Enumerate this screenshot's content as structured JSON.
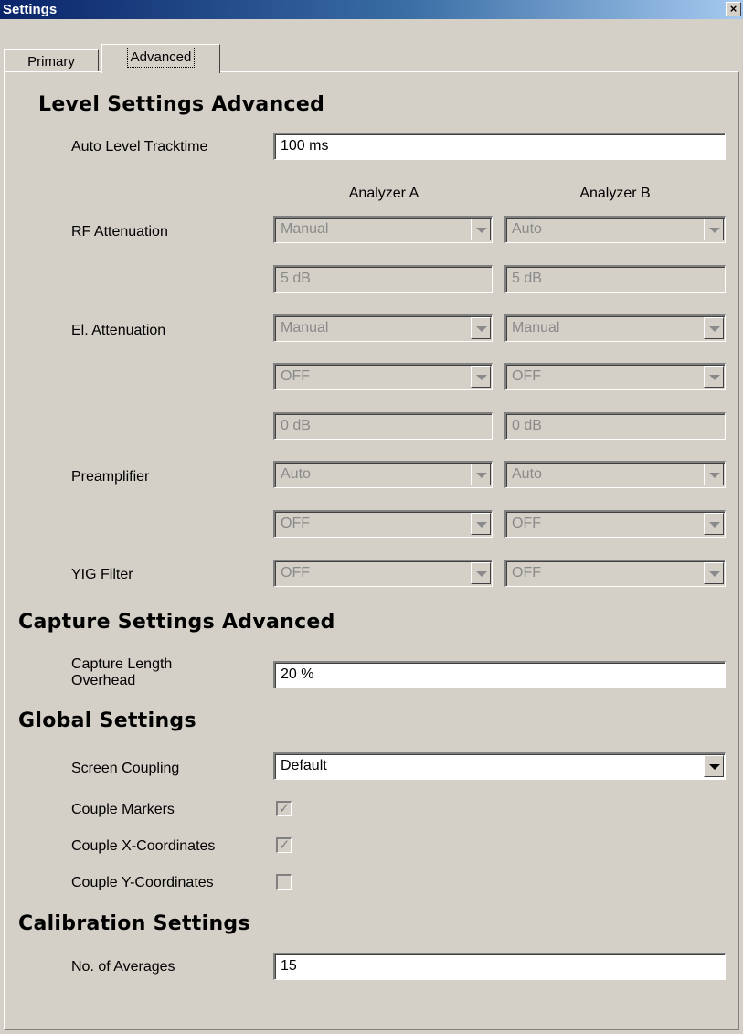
{
  "window": {
    "title": "Settings",
    "close_glyph": "×"
  },
  "tabs": [
    {
      "label": "Primary",
      "active": false
    },
    {
      "label": "Advanced",
      "active": true
    }
  ],
  "level": {
    "heading": "Level Settings Advanced",
    "tracktime_label": "Auto Level Tracktime",
    "tracktime_value": "100 ms",
    "col_a": "Analyzer A",
    "col_b": "Analyzer B",
    "rf_label": "RF Attenuation",
    "rf_mode_a": "Manual",
    "rf_mode_b": "Auto",
    "rf_value_a": "5 dB",
    "rf_value_b": "5 dB",
    "el_label": "El. Attenuation",
    "el_mode_a": "Manual",
    "el_mode_b": "Manual",
    "el_state_a": "OFF",
    "el_state_b": "OFF",
    "el_value_a": "0 dB",
    "el_value_b": "0 dB",
    "pre_label": "Preamplifier",
    "pre_mode_a": "Auto",
    "pre_mode_b": "Auto",
    "pre_state_a": "OFF",
    "pre_state_b": "OFF",
    "yig_label": "YIG Filter",
    "yig_a": "OFF",
    "yig_b": "OFF"
  },
  "capture": {
    "heading": "Capture Settings Advanced",
    "overhead_label_1": "Capture Length",
    "overhead_label_2": "Overhead",
    "overhead_value": "20 %"
  },
  "global": {
    "heading": "Global Settings",
    "screen_coupling_label": "Screen Coupling",
    "screen_coupling_value": "Default",
    "couple_markers_label": "Couple Markers",
    "couple_markers_checked": true,
    "couple_x_label": "Couple X-Coordinates",
    "couple_x_checked": true,
    "couple_y_label": "Couple Y-Coordinates",
    "couple_y_checked": false,
    "check_glyph": "✓"
  },
  "calibration": {
    "heading": "Calibration Settings",
    "averages_label": "No. of Averages",
    "averages_value": "15"
  },
  "colors": {
    "dialog_face": "#d4d0c8",
    "title_gradient_start": "#0a246a",
    "title_gradient_end": "#a6caf0",
    "disabled_text": "#8a8a8a"
  }
}
